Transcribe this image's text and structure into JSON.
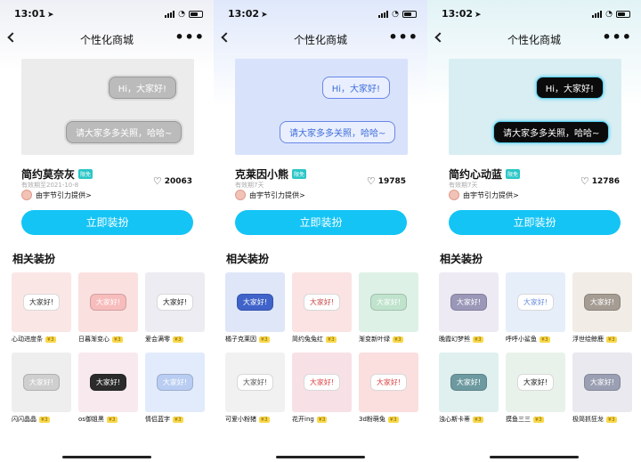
{
  "panels": [
    {
      "time": "13:01",
      "nav_title": "个性化商城",
      "preview_bubble_1": "Hi，大家好!",
      "preview_bubble_2": "请大家多多关照，哈哈~",
      "item_name": "简约莫奈灰",
      "tag": "限免",
      "valid": "有效期至2021-10-8",
      "provider": "由宇节引力提供>",
      "likes": "20063",
      "apply_label": "立即装扮",
      "related_title": "相关装扮",
      "grid": [
        {
          "label": "心动进度条",
          "coin": "¥3",
          "bubble": "大家好!",
          "bg": "#fbe6e6",
          "fg": "#333",
          "bbg": "#ffffff"
        },
        {
          "label": "日暮渐变心",
          "coin": "¥3",
          "bubble": "大家好!",
          "bg": "#fbe0e0",
          "fg": "#ffffff",
          "bbg": "#f7bcbc"
        },
        {
          "label": "爱会满零",
          "coin": "¥3",
          "bubble": "大家好!",
          "bg": "#ececf2",
          "fg": "#222",
          "bbg": "#ffffff"
        },
        {
          "label": "闪闪晶晶",
          "coin": "¥3",
          "bubble": "大家好!",
          "bg": "#eeeeee",
          "fg": "#ffffff",
          "bbg": "#cfcfcf"
        },
        {
          "label": "os御姐黑",
          "coin": "¥3",
          "bubble": "大家好!",
          "bg": "#f8e9ef",
          "fg": "#ffffff",
          "bbg": "#2b2b2b"
        },
        {
          "label": "情侣蓝字",
          "coin": "¥3",
          "bubble": "大家好!",
          "bg": "#e2ebfb",
          "fg": "#ffffff",
          "bbg": "#b9cdf2"
        }
      ]
    },
    {
      "time": "13:02",
      "nav_title": "个性化商城",
      "preview_bubble_1": "Hi，大家好!",
      "preview_bubble_2": "请大家多多关照，哈哈~",
      "item_name": "克莱因小熊",
      "tag": "限免",
      "valid": "有效期7天",
      "provider": "由宇节引力提供>",
      "likes": "19785",
      "apply_label": "立即装扮",
      "related_title": "相关装扮",
      "grid": [
        {
          "label": "橘子克莱因",
          "coin": "¥3",
          "bubble": "大家好!",
          "bg": "#dfe6f8",
          "fg": "#ffffff",
          "bbg": "#3f63c9"
        },
        {
          "label": "简约兔兔红",
          "coin": "¥3",
          "bubble": "大家好!",
          "bg": "#fbe3e3",
          "fg": "#c94a4a",
          "bbg": "#ffffff"
        },
        {
          "label": "渐变新叶绿",
          "coin": "¥3",
          "bubble": "大家好!",
          "bg": "#def1e6",
          "fg": "#ffffff",
          "bbg": "#bfe3cc"
        },
        {
          "label": "可爱小粉猪",
          "coin": "¥3",
          "bubble": "大家好!",
          "bg": "#f1f1f1",
          "fg": "#555",
          "bbg": "#ffffff"
        },
        {
          "label": "花开ing",
          "coin": "¥3",
          "bubble": "大家好!",
          "bg": "#f8e1e6",
          "fg": "#d44",
          "bbg": "#ffffff"
        },
        {
          "label": "3d粉萌兔",
          "coin": "¥3",
          "bubble": "大家好!",
          "bg": "#fbdede",
          "fg": "#d44",
          "bbg": "#ffffff"
        }
      ]
    },
    {
      "time": "13:02",
      "nav_title": "个性化商城",
      "preview_bubble_1": "Hi，大家好!",
      "preview_bubble_2": "请大家多多关照，哈哈~",
      "item_name": "简约心动蓝",
      "tag": "限免",
      "valid": "有效期7天",
      "provider": "由宇节引力提供>",
      "likes": "12786",
      "apply_label": "立即装扮",
      "related_title": "相关装扮",
      "grid": [
        {
          "label": "晚霞幻梦熊",
          "coin": "¥3",
          "bubble": "大家好!",
          "bg": "#eeeaf4",
          "fg": "#ffffff",
          "bbg": "#9a97b8"
        },
        {
          "label": "呼呼小鲨鱼",
          "coin": "¥3",
          "bubble": "大家好!",
          "bg": "#e6eefa",
          "fg": "#6a8ed9",
          "bbg": "#ffffff"
        },
        {
          "label": "浮世绘鲸鹿",
          "coin": "¥3",
          "bubble": "大家好!",
          "bg": "#f1ece6",
          "fg": "#ffffff",
          "bbg": "#a59c93"
        },
        {
          "label": "浊心斯卡蒂",
          "coin": "¥3",
          "bubble": "大家好!",
          "bg": "#dff0ef",
          "fg": "#ffffff",
          "bbg": "#6d9aa0"
        },
        {
          "label": "摸鱼三三",
          "coin": "¥3",
          "bubble": "大家好!",
          "bg": "#e8f2ea",
          "fg": "#222",
          "bbg": "#ffffff"
        },
        {
          "label": "极简抓狂龙",
          "coin": "¥3",
          "bubble": "大家好!",
          "bg": "#e9e9ef",
          "fg": "#ffffff",
          "bbg": "#9b9fb3"
        }
      ]
    }
  ]
}
